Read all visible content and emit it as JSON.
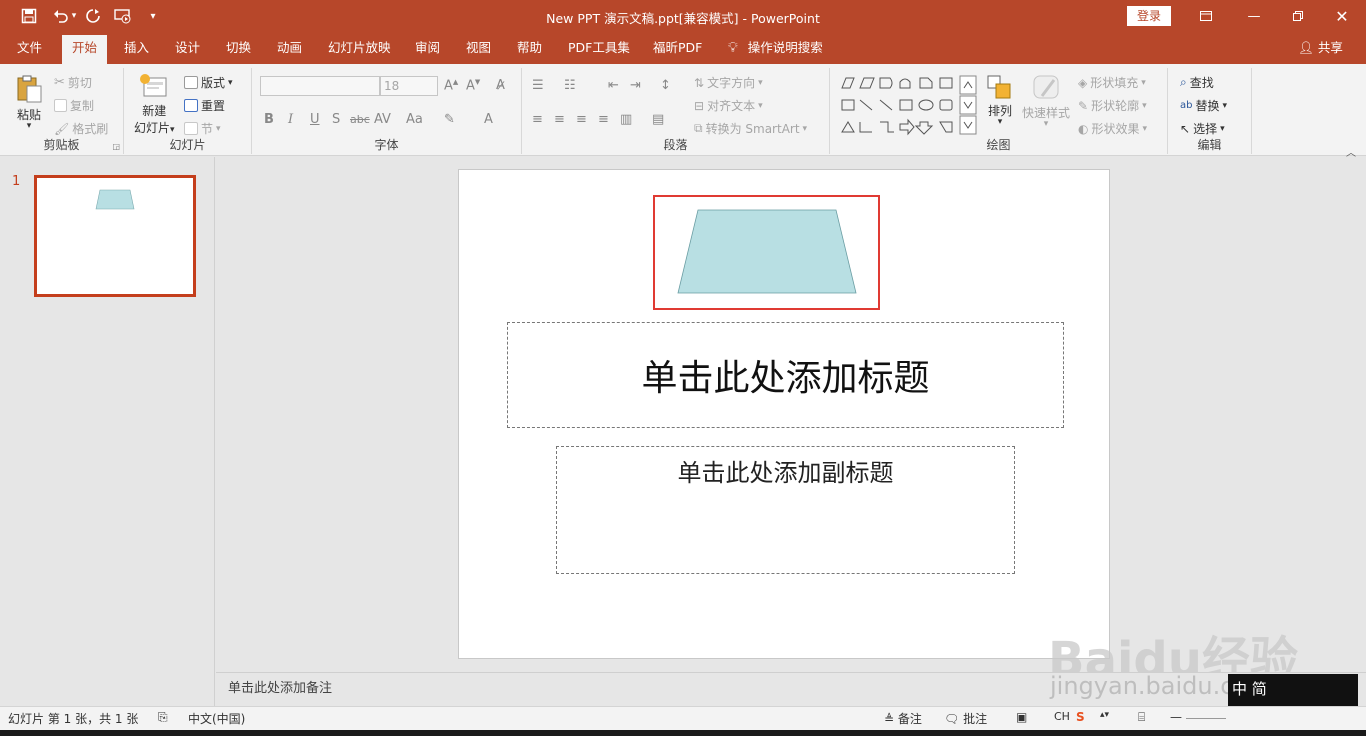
{
  "titlebar": {
    "doc_title": "New PPT 演示文稿.ppt[兼容模式]  -  PowerPoint",
    "login_label": "登录",
    "save_icon": "save-icon",
    "undo_icon": "undo-icon",
    "redo_icon": "redo-icon"
  },
  "tabs": [
    "文件",
    "开始",
    "插入",
    "设计",
    "切换",
    "动画",
    "幻灯片放映",
    "审阅",
    "视图",
    "帮助",
    "PDF工具集",
    "福昕PDF"
  ],
  "active_tab": "开始",
  "tell_me": "操作说明搜索",
  "share": "共享",
  "ribbon": {
    "clipboard": {
      "label": "剪贴板",
      "paste": "粘贴",
      "cut": "剪切",
      "copy": "复制",
      "format_painter": "格式刷"
    },
    "slides": {
      "label": "幻灯片",
      "new_slide_1": "新建",
      "new_slide_2": "幻灯片",
      "layout": "版式",
      "reset": "重置",
      "section": "节"
    },
    "font": {
      "label": "字体",
      "font_name": "",
      "font_size": "18",
      "bold": "B",
      "italic": "I",
      "underline": "U",
      "shadow": "S",
      "strike": "abc",
      "spacing": "AV",
      "case": "Aa",
      "color": "A"
    },
    "paragraph": {
      "label": "段落",
      "text_direction": "文字方向",
      "align_text": "对齐文本",
      "convert_smartart": "转换为 SmartArt"
    },
    "drawing": {
      "label": "绘图",
      "arrange": "排列",
      "quick_styles": "快速样式",
      "shape_fill": "形状填充",
      "shape_outline": "形状轮廓",
      "shape_effects": "形状效果"
    },
    "editing": {
      "label": "编辑",
      "find": "查找",
      "replace": "替换",
      "select": "选择"
    }
  },
  "thumbnails": {
    "number": "1"
  },
  "slide": {
    "title_placeholder": "单击此处添加标题",
    "subtitle_placeholder": "单击此处添加副标题",
    "shape_fill": "#b8dfe3"
  },
  "notes_placeholder": "单击此处添加备注",
  "statusbar": {
    "slide_info": "幻灯片 第 1 张，共 1 张",
    "language": "中文(中国)",
    "notes": "备注",
    "comments": "批注",
    "ime": "CH"
  },
  "watermark": {
    "logo": "Baidu经验",
    "url": "jingyan.baidu.com",
    "stamp": "中 简"
  },
  "colors": {
    "accent": "#b7472a",
    "selection": "#e03a33",
    "thumb_border": "#c43e1c"
  }
}
